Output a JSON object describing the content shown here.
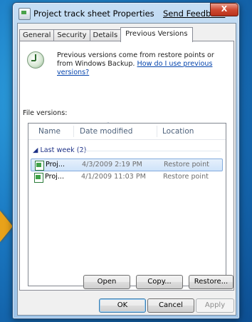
{
  "window": {
    "title": "Project track sheet Properties",
    "feedback_link": "Send Feedback",
    "close_glyph": "X"
  },
  "tabs": [
    {
      "label": "General",
      "active": false
    },
    {
      "label": "Security",
      "active": false
    },
    {
      "label": "Details",
      "active": false
    },
    {
      "label": "Previous Versions",
      "active": true
    }
  ],
  "info": {
    "text": "Previous versions come from restore points or from Windows Backup.",
    "link": "How do I use previous versions?"
  },
  "file_versions_label": "File versions:",
  "columns": [
    "Name",
    "Date modified",
    "Location"
  ],
  "group": {
    "label": "Last week (2)",
    "expanded": true
  },
  "rows": [
    {
      "name": "Proj...",
      "date": "4/3/2009 2:19 PM",
      "location": "Restore point",
      "selected": true
    },
    {
      "name": "Proj...",
      "date": "4/1/2009 11:03 PM",
      "location": "Restore point",
      "selected": false
    }
  ],
  "actions": {
    "open": "Open",
    "copy": "Copy...",
    "restore": "Restore..."
  },
  "dialog_buttons": {
    "ok": "OK",
    "cancel": "Cancel",
    "apply": "Apply"
  }
}
